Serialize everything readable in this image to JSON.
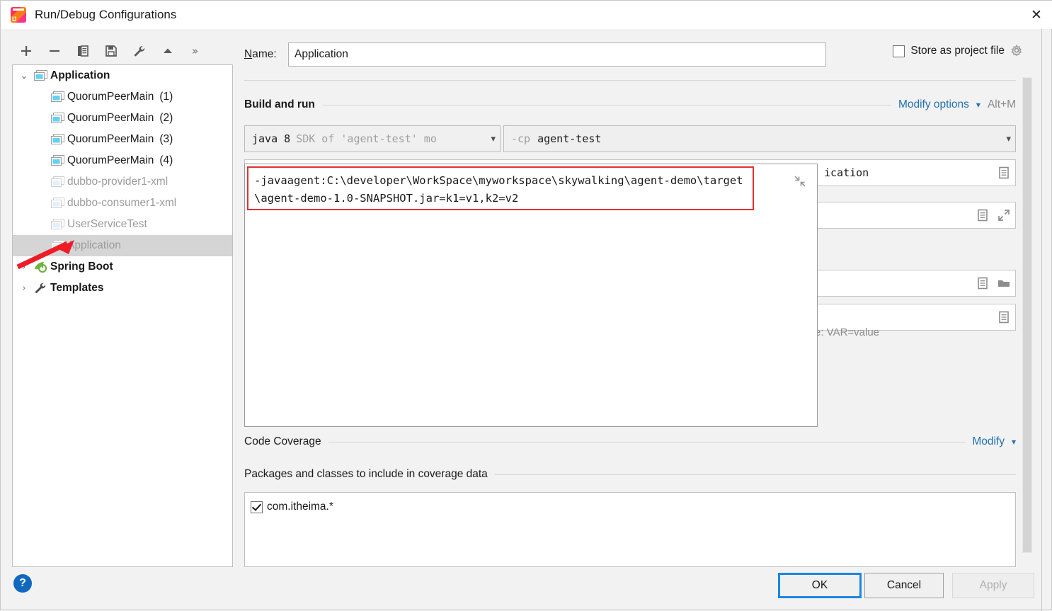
{
  "window": {
    "title": "Run/Debug Configurations",
    "app_icon": "intellij-idea-icon",
    "close_icon": "✕"
  },
  "toolbar": {
    "items": [
      {
        "name": "add-configuration-button",
        "icon": "plus-icon"
      },
      {
        "name": "remove-configuration-button",
        "icon": "minus-icon"
      },
      {
        "name": "copy-configuration-button",
        "icon": "copy-icon"
      },
      {
        "name": "save-configuration-button",
        "icon": "save-icon"
      },
      {
        "name": "edit-templates-button",
        "icon": "wrench-icon"
      },
      {
        "name": "move-up-button",
        "icon": "arrow-up-icon"
      }
    ],
    "more_label": "»"
  },
  "tree": {
    "nodes": [
      {
        "label": "Application",
        "suffix": "",
        "depth": 0,
        "bold": true,
        "dim": false,
        "twisty": "v",
        "icon": "application-config-icon",
        "selected": false
      },
      {
        "label": "QuorumPeerMain",
        "suffix": "(1)",
        "depth": 1,
        "bold": false,
        "dim": false,
        "twisty": "",
        "icon": "application-config-icon",
        "selected": false
      },
      {
        "label": "QuorumPeerMain",
        "suffix": "(2)",
        "depth": 1,
        "bold": false,
        "dim": false,
        "twisty": "",
        "icon": "application-config-icon",
        "selected": false
      },
      {
        "label": "QuorumPeerMain",
        "suffix": "(3)",
        "depth": 1,
        "bold": false,
        "dim": false,
        "twisty": "",
        "icon": "application-config-icon",
        "selected": false
      },
      {
        "label": "QuorumPeerMain",
        "suffix": "(4)",
        "depth": 1,
        "bold": false,
        "dim": false,
        "twisty": "",
        "icon": "application-config-icon",
        "selected": false
      },
      {
        "label": "dubbo-provider1-xml",
        "suffix": "",
        "depth": 1,
        "bold": false,
        "dim": true,
        "twisty": "",
        "icon": "application-config-icon",
        "selected": false
      },
      {
        "label": "dubbo-consumer1-xml",
        "suffix": "",
        "depth": 1,
        "bold": false,
        "dim": true,
        "twisty": "",
        "icon": "application-config-icon",
        "selected": false
      },
      {
        "label": "UserServiceTest",
        "suffix": "",
        "depth": 1,
        "bold": false,
        "dim": true,
        "twisty": "",
        "icon": "application-config-icon",
        "selected": false
      },
      {
        "label": "Application",
        "suffix": "",
        "depth": 1,
        "bold": false,
        "dim": true,
        "twisty": "",
        "icon": "application-config-icon",
        "selected": true
      },
      {
        "label": "Spring Boot",
        "suffix": "",
        "depth": 0,
        "bold": true,
        "dim": false,
        "twisty": ">",
        "icon": "spring-boot-icon",
        "selected": false
      },
      {
        "label": "Templates",
        "suffix": "",
        "depth": 0,
        "bold": true,
        "dim": false,
        "twisty": ">",
        "icon": "wrench-icon",
        "selected": false
      }
    ]
  },
  "form": {
    "name_label": "Name:",
    "name_value": "Application",
    "name_placeholder": "",
    "store_as_project_file_label": "Store as project file",
    "store_as_project_file_checked": false,
    "store_gear_icon": "gear-icon"
  },
  "build_and_run": {
    "title": "Build and run",
    "modify_options_label": "Modify options",
    "modify_options_shortcut": "Alt+M",
    "jdk_value_dark": "java 8",
    "jdk_value_dim": "SDK of 'agent-test' mo",
    "classpath_prefix": "-cp",
    "classpath_value": "agent-test",
    "vm_options_text": "-javaagent:C:\\developer\\WorkSpace\\myworkspace\\skywalking\\agent-demo\\target\\agent-demo-1.0-SNAPSHOT.jar=k1=v1,k2=v2",
    "vm_options_border_color": "#e03131",
    "collapse_icon": "collapse-icon",
    "background_fields": [
      {
        "name": "main-class-field",
        "value": "ication",
        "icons": [
          "document-icon"
        ]
      },
      {
        "name": "program-arguments-field",
        "value": "",
        "icons": [
          "document-icon",
          "expand-icon"
        ]
      },
      {
        "name": "working-directory-field",
        "value": "",
        "icons": [
          "document-icon",
          "folder-icon"
        ]
      },
      {
        "name": "environment-variables-field",
        "value": "",
        "icons": [
          "document-icon"
        ]
      }
    ],
    "env_hint": "e: VAR=value"
  },
  "code_coverage": {
    "title": "Code Coverage",
    "modify_label": "Modify",
    "packages_title": "Packages and classes to include in coverage data",
    "items": [
      {
        "label": "com.itheima.*",
        "checked": true
      }
    ]
  },
  "footer": {
    "help_label": "?",
    "ok_label": "OK",
    "cancel_label": "Cancel",
    "apply_label": "Apply",
    "apply_enabled": false
  },
  "annotation": {
    "arrow_color": "#ee1c25",
    "points_to": "tree-row-application-selected"
  },
  "colors": {
    "accent_link": "#2470b3",
    "selection": "#d5d5d5",
    "ok_focus_border": "#1a86e0",
    "red_highlight": "#e03131"
  }
}
